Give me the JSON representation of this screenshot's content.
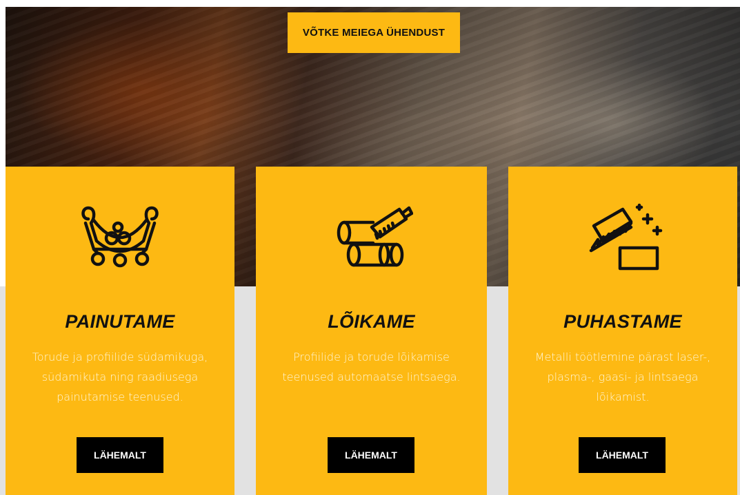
{
  "hero": {
    "contact_button": "VÕTKE MEIEGA ÜHENDUST"
  },
  "services": [
    {
      "icon": "pipe-bending-icon",
      "title": "PAINUTAME",
      "description": "Torude ja profiilide südamikuga, südamikuta ning raadiusega painutamise teenused.",
      "button": "LÄHEMALT"
    },
    {
      "icon": "pipe-cutting-saw-icon",
      "title": "LÕIKAME",
      "description": "Profiilide ja torude lõikamise teenused automaatse lintsaega.",
      "button": "LÄHEMALT"
    },
    {
      "icon": "cleaning-brush-icon",
      "title": "PUHASTAME",
      "description": "Metalli töötlemine pärast laser-, plasma-, gaasi- ja lintsaega lõikamist.",
      "button": "LÄHEMALT"
    }
  ],
  "colors": {
    "accent": "#fdb913",
    "button_dark": "#000000",
    "text_light": "#fff6d8",
    "band_grey": "#e2e2e2"
  }
}
